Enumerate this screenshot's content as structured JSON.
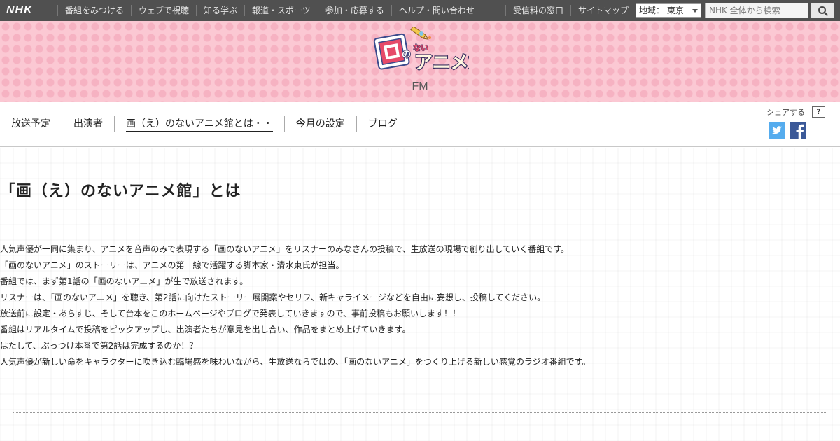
{
  "global_nav": {
    "logo": "NHK",
    "items": [
      "番組をみつける",
      "ウェブで視聴",
      "知る学ぶ",
      "報道・スポーツ",
      "参加・応募する",
      "ヘルプ・問い合わせ"
    ],
    "right_items": [
      "受信料の窓口",
      "サイトマップ"
    ],
    "region_label": "地域：",
    "region_value": "東京",
    "search_placeholder": "NHK 全体から検索",
    "search_icon": "search-icon"
  },
  "header": {
    "logo_text": "画のないアニメ館",
    "channel": "FM",
    "colors": {
      "background": "#fbc8d3",
      "dots": "#f6b2c2"
    }
  },
  "program_nav": {
    "tabs": [
      {
        "label": "放送予定",
        "active": false
      },
      {
        "label": "出演者",
        "active": false
      },
      {
        "label": "画（え）のないアニメ館とは・・",
        "active": true
      },
      {
        "label": "今月の設定",
        "active": false
      },
      {
        "label": "ブログ",
        "active": false
      }
    ],
    "share_label": "シェアする",
    "help_label": "?",
    "share_icons": [
      "twitter-icon",
      "facebook-icon"
    ]
  },
  "main": {
    "title": "「画（え）のないアニメ館」とは",
    "paragraphs": [
      "人気声優が一同に集まり、アニメを音声のみで表現する「画のないアニメ」をリスナーのみなさんの投稿で、生放送の現場で創り出していく番組です。",
      "「画のないアニメ」のストーリーは、アニメの第一線で活躍する脚本家・清水東氏が担当。",
      "番組では、まず第1話の「画のないアニメ」が生で放送されます。",
      "リスナーは、「画のないアニメ」を聴き、第2話に向けたストーリー展開案やセリフ、新キャライメージなどを自由に妄想し、投稿してください。",
      "放送前に設定・あらすじ、そして台本をこのホームページやブログで発表していきますので、事前投稿もお願いします！！",
      "番組はリアルタイムで投稿をピックアップし、出演者たちが意見を出し合い、作品をまとめ上げていきます。",
      "はたして、ぶっつけ本番で第2話は完成するのか！？",
      "人気声優が新しい命をキャラクターに吹き込む臨場感を味わいながら、生放送ならではの、「画のないアニメ」をつくり上げる新しい感覚のラジオ番組です。"
    ]
  }
}
